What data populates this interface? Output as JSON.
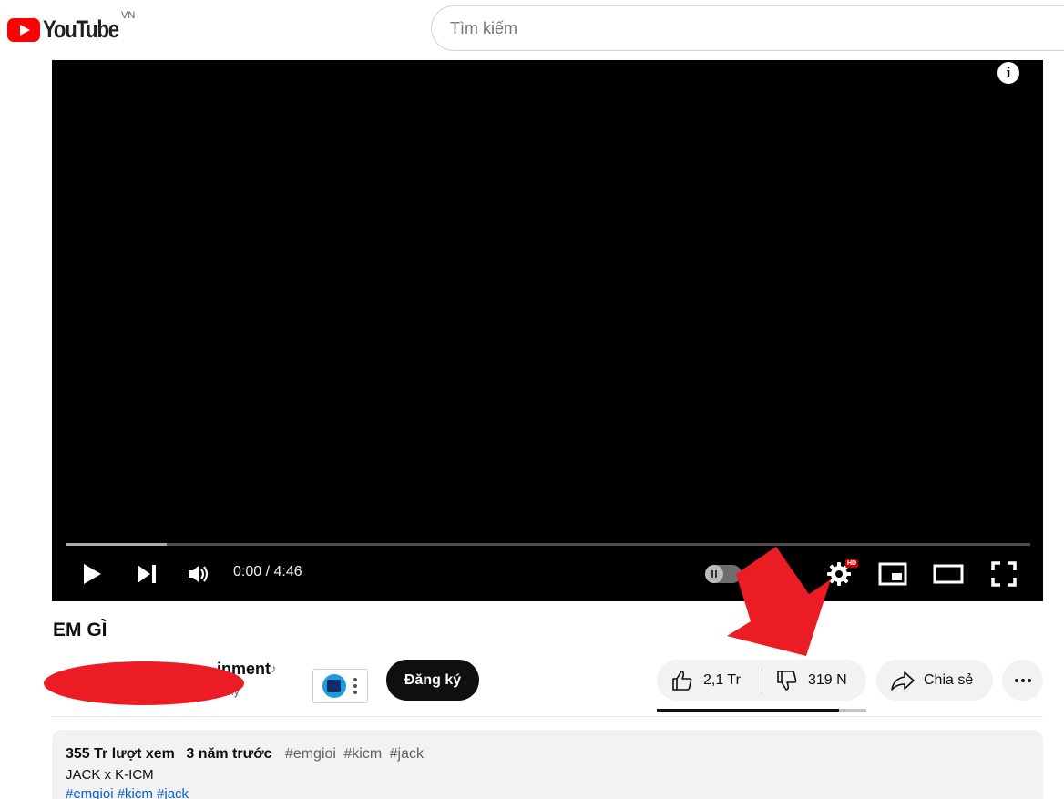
{
  "header": {
    "logo_text": "YouTube",
    "country_code": "VN",
    "search_placeholder": "Tìm kiếm"
  },
  "player": {
    "time_display": "0:00 / 4:46",
    "hd_badge": "HD",
    "info_symbol": "i",
    "buffered_fraction": 0.105
  },
  "video": {
    "title": "EM GÌ"
  },
  "channel": {
    "name_visible": "inment",
    "subscribers_visible": "ký",
    "subscribe_label": "Đăng ký"
  },
  "actions": {
    "like_count": "2,1 Tr",
    "dislike_count": "319 N",
    "share_label": "Chia sẻ",
    "like_ratio": 0.87
  },
  "description": {
    "views": "355 Tr lượt xem",
    "uploaded": "3 năm trước",
    "hashtags": [
      "#emgioi",
      "#kicm",
      "#jack"
    ],
    "first_line": "JACK x K-ICM",
    "tags_line": "#emgioi #kicm #jack"
  },
  "colors": {
    "brand_red": "#ff0000",
    "annotation_red": "#ec1c24",
    "pill_bg": "#f2f2f2",
    "link_blue": "#065fd4"
  }
}
